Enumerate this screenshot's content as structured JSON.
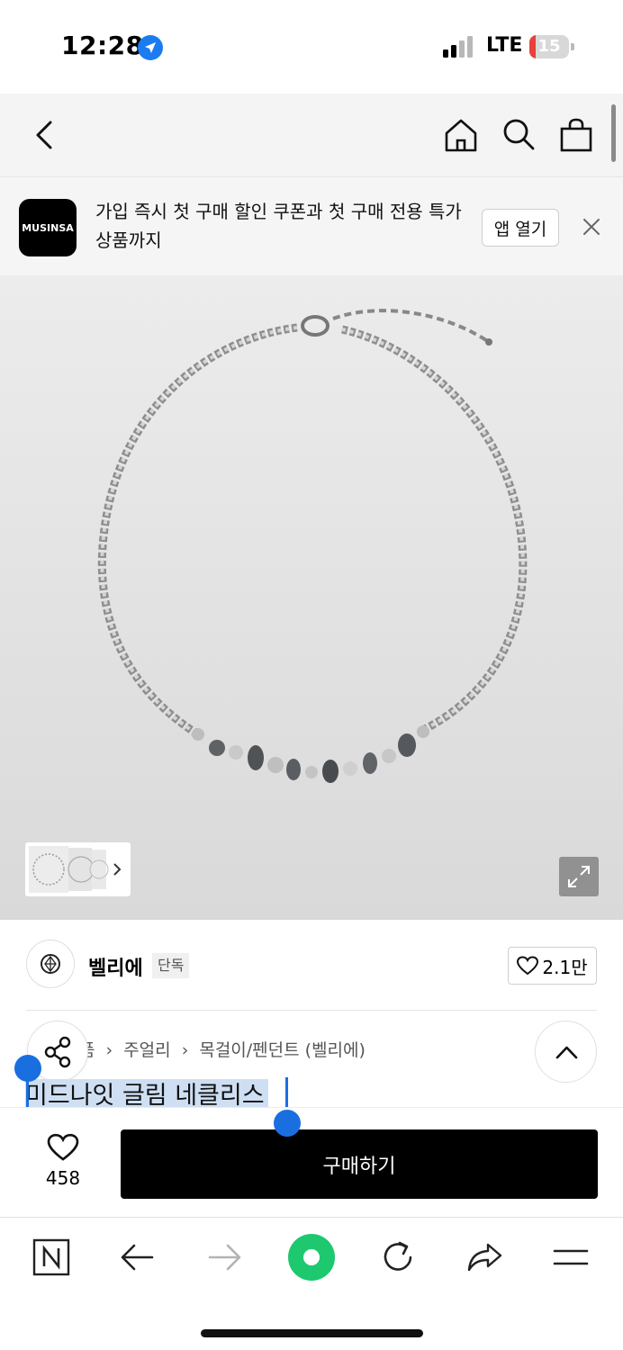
{
  "status_bar": {
    "time": "12:28",
    "network": "LTE",
    "battery_level": "15",
    "battery_fraction": 0.15
  },
  "app_banner": {
    "logo_text": "MUSINSA",
    "message": "가입 즉시 첫 구매 할인 쿠폰과 첫 구매 전용 특가 상품까지",
    "open_label": "앱 열기"
  },
  "brand": {
    "name": "벨리에",
    "badge": "단독",
    "likes": "2.1만"
  },
  "breadcrumb": {
    "items": [
      "품",
      "주얼리",
      "목걸이/펜던트 (벨리에)"
    ],
    "separator": "›"
  },
  "product": {
    "title": "미드나잇 글림 네클리스"
  },
  "bottom_bar": {
    "wish_count": "458",
    "buy_label": "구매하기"
  },
  "colors": {
    "accent_blue": "#1a6fe0",
    "selection": "#cfdff3",
    "buy_button": "#000000",
    "battery_low": "#e8413c",
    "toolbar_green": "#1ec86e"
  },
  "icons": {
    "navbar": [
      "back-icon",
      "home-icon",
      "search-icon",
      "cart-icon"
    ],
    "toolbar": [
      "naver-icon",
      "back-arrow-icon",
      "forward-arrow-icon",
      "green-dot-icon",
      "reload-icon",
      "share-icon",
      "menu-icon"
    ]
  }
}
